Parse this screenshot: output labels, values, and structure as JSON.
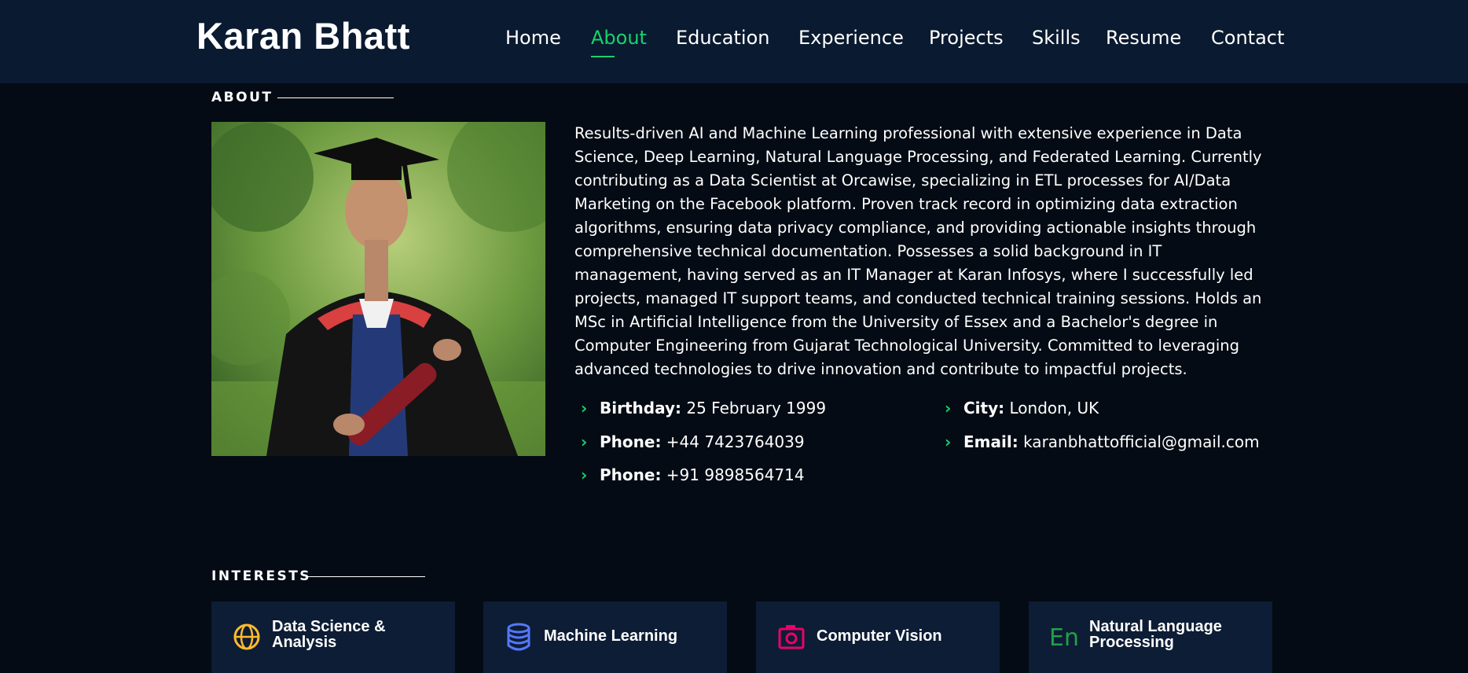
{
  "header": {
    "logo": "Karan Bhatt",
    "nav": [
      "Home",
      "About",
      "Education",
      "Experience",
      "Projects",
      "Skills",
      "Resume",
      "Contact"
    ],
    "active": "About"
  },
  "about": {
    "title": "ABOUT",
    "bio": "Results-driven AI and Machine Learning professional with extensive experience in Data Science, Deep Learning, Natural Language Processing, and Federated Learning. Currently contributing as a Data Scientist at Orcawise, specializing in ETL processes for AI/Data Marketing on the Facebook platform. Proven track record in optimizing data extraction algorithms, ensuring data privacy compliance, and providing actionable insights through comprehensive technical documentation. Possesses a solid background in IT management, having served as an IT Manager at Karan Infosys, where I successfully led projects, managed IT support teams, and conducted technical training sessions. Holds an MSc in Artificial Intelligence from the University of Essex and a Bachelor's degree in Computer Engineering from Gujarat Technological University. Committed to leveraging advanced technologies to drive innovation and contribute to impactful projects.",
    "info": [
      {
        "label": "Birthday:",
        "value": "25 February 1999"
      },
      {
        "label": "Phone:",
        "value": "+44 7423764039"
      },
      {
        "label": "Phone:",
        "value": "+91 9898564714"
      },
      {
        "label": "City:",
        "value": "London, UK"
      },
      {
        "label": "Email:",
        "value": "karanbhattofficial@gmail.com"
      }
    ]
  },
  "interests": {
    "title": "INTERESTS",
    "items": [
      {
        "label": "Data Science & Analysis",
        "icon": "globe-icon",
        "color": "#ffbb2c"
      },
      {
        "label": "Machine Learning",
        "icon": "database-icon",
        "color": "#5578ff"
      },
      {
        "label": "Computer Vision",
        "icon": "camera-icon",
        "color": "#e80368"
      },
      {
        "label": "Natural Language Processing",
        "icon": "language-icon",
        "color": "#11dbcf"
      }
    ]
  },
  "colors": {
    "accent": "#18d26e",
    "background": "#040b14",
    "header": "#0a1a30",
    "card": "#0d1d35"
  }
}
